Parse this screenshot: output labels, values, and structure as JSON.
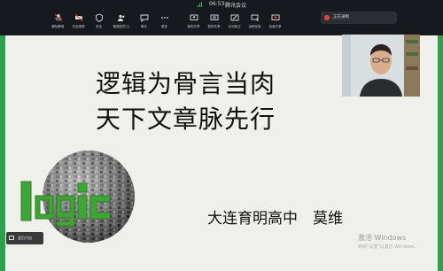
{
  "titlebar": {
    "time": "06:53",
    "app_name": "腾讯会议"
  },
  "toolbar": {
    "items": [
      {
        "label": "解除静音",
        "icon": "mic-muted-icon"
      },
      {
        "label": "开启视频",
        "icon": "camera-icon"
      },
      {
        "label": "安全",
        "icon": "shield-icon"
      },
      {
        "label": "管理成员(1)",
        "icon": "members-icon"
      },
      {
        "label": "聊天",
        "icon": "chat-icon"
      },
      {
        "label": "更多",
        "icon": "more-icon"
      },
      {
        "label": "新的共享",
        "icon": "share-screen-icon"
      },
      {
        "label": "暂停共享",
        "icon": "pause-share-icon"
      },
      {
        "label": "互动批注",
        "icon": "annotate-icon"
      },
      {
        "label": "远程控制",
        "icon": "remote-control-icon"
      },
      {
        "label": "结束共享",
        "icon": "stop-share-icon"
      }
    ]
  },
  "recording": {
    "label": "正在录制"
  },
  "slide": {
    "line1": "逻辑为骨言当肉",
    "line2": "天下文章脉先行",
    "author": "大连育明高中　莫维",
    "logo_text": "logic"
  },
  "windows_watermark": {
    "line1": "激活 Windows",
    "line2": "转到\"设置\"以激活 Windows。"
  },
  "mini_control": {
    "label": "此后付出"
  }
}
